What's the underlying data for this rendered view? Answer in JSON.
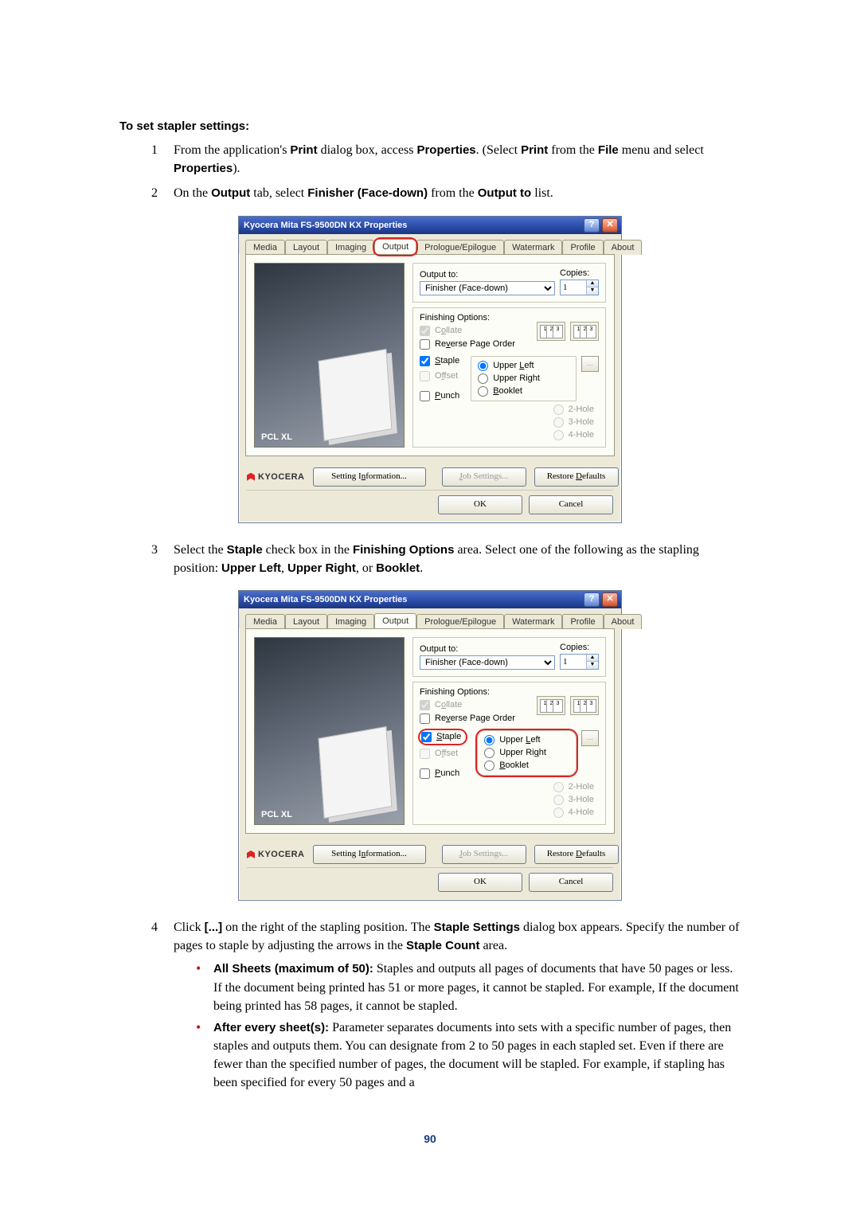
{
  "heading": "To set stapler settings:",
  "steps": {
    "s1": {
      "pre": "From the application's ",
      "b1": "Print",
      "mid1": " dialog box, access ",
      "b2": "Properties",
      "mid2": ". (Select ",
      "b3": "Print",
      "mid3": " from the ",
      "b4": "File",
      "mid4": " menu and select ",
      "b5": "Properties",
      "post": ")."
    },
    "s2": {
      "pre": "On the ",
      "b1": "Output",
      "mid1": " tab, select ",
      "b2": "Finisher (Face-down)",
      "mid2": " from the ",
      "b3": "Output to",
      "post": " list."
    },
    "s3": {
      "pre": "Select the ",
      "b1": "Staple",
      "mid1": " check box in the ",
      "b2": "Finishing Options",
      "mid2": " area. Select one of the following as the stapling position: ",
      "b3": "Upper Left",
      "sep1": ", ",
      "b4": "Upper Right",
      "sep2": ", or ",
      "b5": "Booklet",
      "post": "."
    },
    "s4": {
      "pre": "Click ",
      "b1": "[...]",
      "mid1": " on the right of the stapling position. The ",
      "b2": "Staple Settings",
      "mid2": " dialog box appears. Specify the number of pages to staple by adjusting the arrows in the ",
      "b3": "Staple Count",
      "post": " area."
    }
  },
  "bullets": {
    "b1": {
      "title": "All Sheets (maximum of 50):",
      "text": " Staples and outputs all pages of documents that have 50 pages or less. If the document being printed has 51 or more pages, it cannot be stapled. For example, If the document being printed has 58 pages, it cannot be stapled."
    },
    "b2": {
      "title": "After every sheet(s):",
      "text": " Parameter separates documents into sets with a specific number of pages, then staples and outputs them. You can designate from 2 to 50 pages in each stapled set. Even if there are fewer than the specified number of pages, the document will be stapled. For example, if stapling has been specified for every 50 pages and a"
    }
  },
  "dialog": {
    "title": "Kyocera Mita FS-9500DN KX Properties",
    "help": "?",
    "close": "✕",
    "tabs": [
      "Media",
      "Layout",
      "Imaging",
      "Output",
      "Prologue/Epilogue",
      "Watermark",
      "Profile",
      "About"
    ],
    "output_to_label": "Output to:",
    "output_to_value": "Finisher (Face-down)",
    "copies_label": "Copies:",
    "copies_value": "1",
    "finishing_label": "Finishing Options:",
    "collate": "Collate",
    "reverse": "Reverse Page Order",
    "staple": "Staple",
    "offset": "Offset",
    "punch": "Punch",
    "pos": {
      "ul": "Upper Left",
      "ur": "Upper Right",
      "bk": "Booklet"
    },
    "holes": {
      "h2": "2-Hole",
      "h3": "3-Hole",
      "h4": "4-Hole"
    },
    "preview_label": "PCL XL",
    "brand": "KYOCERA",
    "setting_info": "Setting Information...",
    "job_settings": "Job Settings...",
    "restore": "Restore Defaults",
    "ok": "OK",
    "cancel": "Cancel",
    "dots": "..."
  },
  "page_number": "90",
  "coll": {
    "d1": "1",
    "d2": "2",
    "d3": "3"
  }
}
